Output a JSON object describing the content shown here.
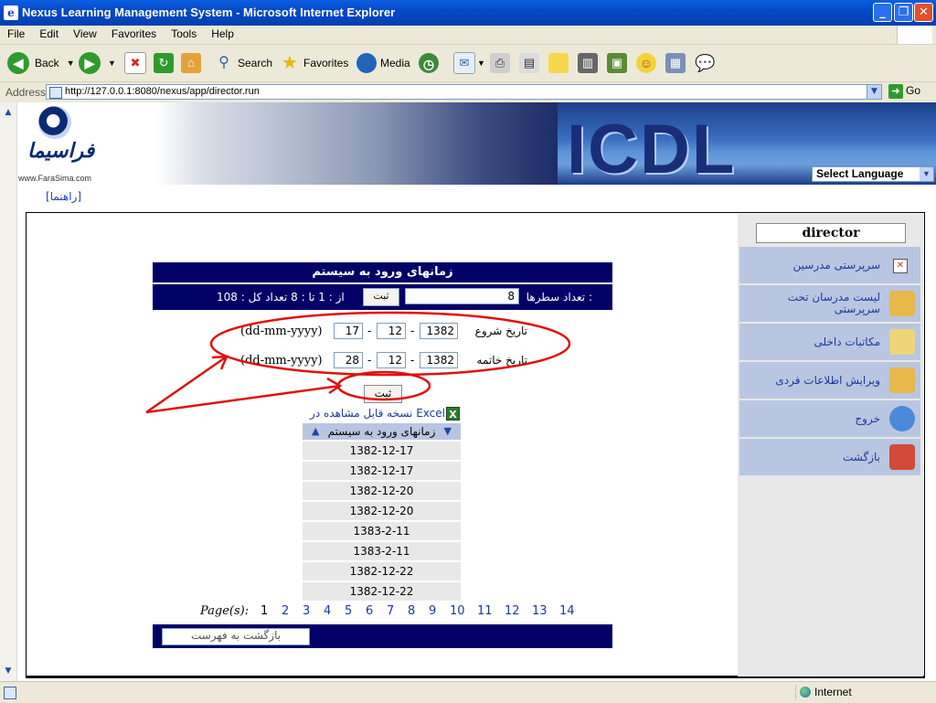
{
  "window": {
    "title": "Nexus Learning Management System - Microsoft Internet Explorer"
  },
  "menu": [
    "File",
    "Edit",
    "View",
    "Favorites",
    "Tools",
    "Help"
  ],
  "toolbar": {
    "back": "Back",
    "search": "Search",
    "favorites": "Favorites",
    "media": "Media"
  },
  "address": {
    "label": "Address",
    "url": "http://127.0.0.1:8080/nexus/app/director.run",
    "go": "Go"
  },
  "banner": {
    "logo_text": "فراسیما",
    "logo_url": "www.FaraSima.com",
    "brand": "ICDL",
    "language": "Select Language"
  },
  "help_link": "[راهنما]",
  "user": "director",
  "side_menu": [
    {
      "label": "سرپرستی مدرسین",
      "icon": "close-icon",
      "color": "#c0392b"
    },
    {
      "label": "لیست مدرسان تحت سرپرستی",
      "icon": "magnifier-icon",
      "color": "#d4a017"
    },
    {
      "label": "مکاتبات داخلی",
      "icon": "envelope-icon",
      "color": "#d4a017"
    },
    {
      "label": "ویرایش اطلاعات فردی",
      "icon": "magnifier-icon",
      "color": "#d4a017"
    },
    {
      "label": "خروج",
      "icon": "exit-icon",
      "color": "#3a7bd5"
    },
    {
      "label": "بازگشت",
      "icon": "home-icon",
      "color": "#c0392b"
    }
  ],
  "report": {
    "title": "زمانهای ورود به سیستم",
    "rows_label": "تعداد سطرها :",
    "rows_value": "8",
    "apply_label": "ثبت",
    "info": "از : 1   تا : 8   تعداد کل : 108",
    "start_label": "تاریخ شروع",
    "end_label": "تاریخ خاتمه",
    "start": {
      "year": "1382",
      "month": "12",
      "day": "17"
    },
    "end": {
      "year": "1382",
      "month": "12",
      "day": "28"
    },
    "date_format": "(dd-mm-yyyy)",
    "submit_label": "ثبت",
    "excel_label": "نسخه قابل مشاهده در Excel",
    "column_header": "زمانهای ورود به سیستم",
    "rows": [
      "1382-12-17",
      "1382-12-17",
      "1382-12-20",
      "1382-12-20",
      "1383-2-11",
      "1383-2-11",
      "1382-12-22",
      "1382-12-22"
    ],
    "pages_label": "Page(s):",
    "pages": [
      "1",
      "2",
      "3",
      "4",
      "5",
      "6",
      "7",
      "8",
      "9",
      "10",
      "11",
      "12",
      "13",
      "14"
    ],
    "back_label": "بازگشت به فهرست"
  },
  "status": {
    "zone": "Internet"
  }
}
